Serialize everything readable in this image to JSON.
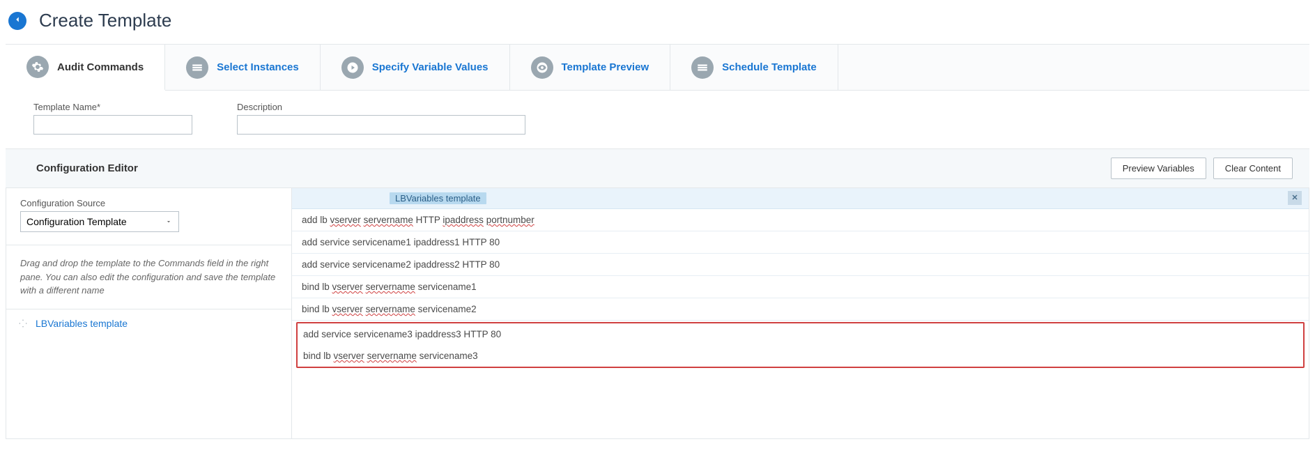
{
  "header": {
    "title": "Create Template"
  },
  "tabs": [
    {
      "label": "Audit Commands",
      "icon": "gear",
      "active": true
    },
    {
      "label": "Select Instances",
      "icon": "stack",
      "active": false
    },
    {
      "label": "Specify Variable Values",
      "icon": "play-circle",
      "active": false
    },
    {
      "label": "Template Preview",
      "icon": "eye-circle",
      "active": false
    },
    {
      "label": "Schedule Template",
      "icon": "stack",
      "active": false
    }
  ],
  "fields": {
    "template_name_label": "Template Name*",
    "template_name_value": "",
    "description_label": "Description",
    "description_value": ""
  },
  "config_bar": {
    "title": "Configuration Editor",
    "preview_btn": "Preview Variables",
    "clear_btn": "Clear Content"
  },
  "left_pane": {
    "source_label": "Configuration Source",
    "source_selected": "Configuration Template",
    "hint": "Drag and drop the template to the Commands field in the right pane. You can also edit the configuration and save the template with a different name",
    "draggable_template": "LBVariables template"
  },
  "right_pane": {
    "chip": "LBVariables template",
    "commands": [
      {
        "parts": [
          "add lb ",
          {
            "sp": "vserver"
          },
          " ",
          {
            "sp": "servername"
          },
          " HTTP ",
          {
            "sp": "ipaddress"
          },
          " ",
          {
            "sp": "portnumber"
          }
        ]
      },
      {
        "parts": [
          "add service servicename1 ipaddress1 HTTP 80"
        ]
      },
      {
        "parts": [
          "add service servicename2 ipaddress2 HTTP 80"
        ]
      },
      {
        "parts": [
          "bind lb ",
          {
            "sp": "vserver"
          },
          " ",
          {
            "sp": "servername"
          },
          " servicename1"
        ]
      },
      {
        "parts": [
          "bind lb ",
          {
            "sp": "vserver"
          },
          " ",
          {
            "sp": "servername"
          },
          " servicename2"
        ]
      }
    ],
    "highlighted_commands": [
      {
        "parts": [
          "add service servicename3 ipaddress3 HTTP 80"
        ]
      },
      {
        "parts": [
          "bind lb ",
          {
            "sp": "vserver"
          },
          " ",
          {
            "sp": "servername"
          },
          " servicename3"
        ]
      }
    ]
  }
}
